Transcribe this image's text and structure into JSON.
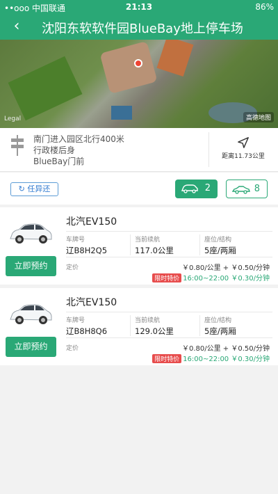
{
  "status_bar": {
    "carrier": "••ooo 中国联通",
    "time": "21:13",
    "battery": "86%"
  },
  "header": {
    "back_icon": "chevron-left-icon",
    "title": "沈阳东软软件园BlueBay地上停车场"
  },
  "map": {
    "legal": "Legal",
    "tag": "高德地图"
  },
  "route": {
    "line1": "南门进入园区北行400米",
    "line2": "行政楼后身",
    "line3": "BlueBay门前",
    "distance_label": "距离11.73公里"
  },
  "filter": {
    "return_anywhere": "任异还",
    "car_count": "2",
    "ev_count": "8"
  },
  "cars": [
    {
      "name": "北汽EV150",
      "book_label": "立即预约",
      "plate_key": "车牌号",
      "plate": "辽B8H2Q5",
      "range_key": "当前续航",
      "range": "117.0公里",
      "seat_key": "座位/结构",
      "seat": "5座/两厢",
      "price_key": "定价",
      "price_line": "￥0.80/公里 + ￥0.50/分钟",
      "promo_label": "限时特价",
      "promo_line": "16:00~22:00 ￥0.30/分钟"
    },
    {
      "name": "北汽EV150",
      "book_label": "立即预约",
      "plate_key": "车牌号",
      "plate": "辽B8H8Q6",
      "range_key": "当前续航",
      "range": "129.0公里",
      "seat_key": "座位/结构",
      "seat": "5座/两厢",
      "price_key": "定价",
      "price_line": "￥0.80/公里 + ￥0.50/分钟",
      "promo_label": "限时特价",
      "promo_line": "16:00~22:00 ￥0.30/分钟"
    }
  ],
  "colors": {
    "brand": "#2aa876",
    "promo": "#e74c4c",
    "link": "#2f7ad0"
  }
}
